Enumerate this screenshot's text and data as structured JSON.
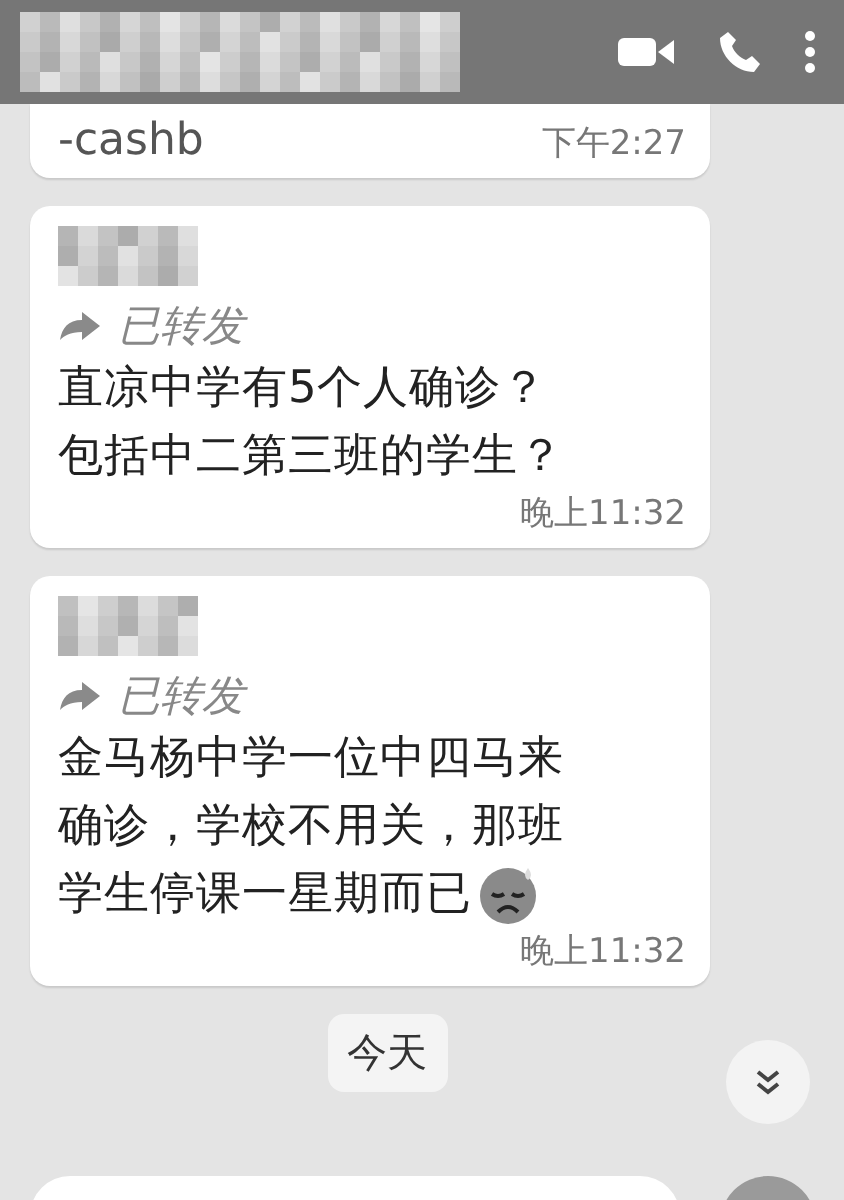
{
  "messages": [
    {
      "kind": "partial",
      "lines": [
        "-cashb"
      ],
      "time": "下午2:27",
      "trailing_emoji": false
    },
    {
      "kind": "forwarded",
      "forwarded_label": "已转发",
      "lines": [
        "直凉中学有5个人确诊？",
        "包括中二第三班的学生？"
      ],
      "time": "晚上11:32",
      "trailing_emoji": false
    },
    {
      "kind": "forwarded",
      "forwarded_label": "已转发",
      "lines": [
        "金马杨中学一位中四马来",
        "确诊，学校不用关，那班",
        "学生停课一星期而已"
      ],
      "time": "晚上11:32",
      "trailing_emoji": true
    }
  ],
  "date_chip": "今天"
}
